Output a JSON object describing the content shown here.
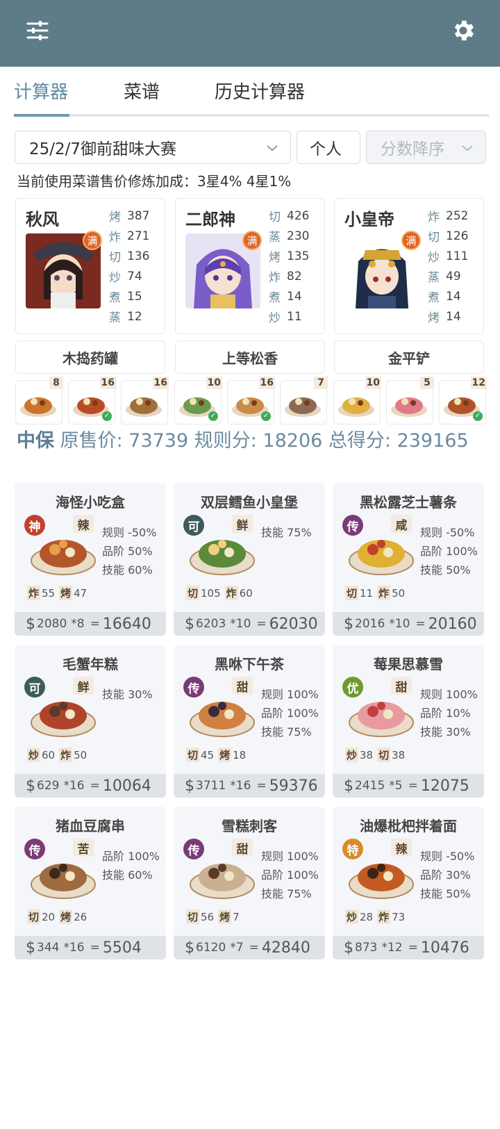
{
  "appbar": {
    "filter_icon": "sliders-icon",
    "settings_icon": "gear-icon"
  },
  "tabs": [
    {
      "label": "计算器",
      "active": true
    },
    {
      "label": "菜谱",
      "active": false
    },
    {
      "label": "历史计算器",
      "active": false
    }
  ],
  "filters": {
    "contest": "25/2/7御前甜味大赛",
    "mode": "个人",
    "sort": "分数降序"
  },
  "bonus_text": "当前使用菜谱售价修炼加成：3星4% 4星1%",
  "chefs": [
    {
      "name": "秋风",
      "badge": "满",
      "skills": [
        [
          "烤",
          "387"
        ],
        [
          "炸",
          "271"
        ],
        [
          "切",
          "136"
        ],
        [
          "炒",
          "74"
        ],
        [
          "煮",
          "15"
        ],
        [
          "蒸",
          "12"
        ]
      ]
    },
    {
      "name": "二郎神",
      "badge": "满",
      "skills": [
        [
          "切",
          "426"
        ],
        [
          "蒸",
          "230"
        ],
        [
          "烤",
          "135"
        ],
        [
          "炸",
          "82"
        ],
        [
          "煮",
          "14"
        ],
        [
          "炒",
          "11"
        ]
      ]
    },
    {
      "name": "小皇帝",
      "badge": "满",
      "skills": [
        [
          "炸",
          "252"
        ],
        [
          "切",
          "126"
        ],
        [
          "炒",
          "111"
        ],
        [
          "蒸",
          "49"
        ],
        [
          "煮",
          "14"
        ],
        [
          "烤",
          "14"
        ]
      ]
    }
  ],
  "equipment": [
    "木捣药罐",
    "上等松香",
    "金平铲"
  ],
  "materials": [
    {
      "count": "8",
      "checked": false
    },
    {
      "count": "16",
      "checked": true
    },
    {
      "count": "16",
      "checked": false
    },
    {
      "count": "10",
      "checked": true
    },
    {
      "count": "16",
      "checked": true
    },
    {
      "count": "7",
      "checked": false
    },
    {
      "count": "10",
      "checked": false
    },
    {
      "count": "5",
      "checked": false
    },
    {
      "count": "12",
      "checked": true
    }
  ],
  "summary": {
    "grade": "中保",
    "text": " 原售价:  73739 规则分:  18206 总得分:  239165"
  },
  "dishes": [
    {
      "name": "海怪小吃盒",
      "rarity": "神",
      "rarity_color": "#c2402e",
      "flavor": "辣",
      "bonuses": [
        "规则 -50%",
        "品阶 50%",
        "技能 60%"
      ],
      "reqs": [
        [
          "炸",
          "55"
        ],
        [
          "烤",
          "47"
        ]
      ],
      "price": "2080",
      "qty": "*8",
      "total": "16640"
    },
    {
      "name": "双层鳕鱼小皇堡",
      "rarity": "可",
      "rarity_color": "#3d5a5c",
      "flavor": "鲜",
      "bonuses": [
        "技能 75%"
      ],
      "reqs": [
        [
          "切",
          "105"
        ],
        [
          "炸",
          "60"
        ]
      ],
      "price": "6203",
      "qty": "*10",
      "total": "62030"
    },
    {
      "name": "黑松露芝士薯条",
      "rarity": "传",
      "rarity_color": "#7b3a78",
      "flavor": "咸",
      "bonuses": [
        "规则 -50%",
        "品阶 100%",
        "技能 50%"
      ],
      "reqs": [
        [
          "切",
          "11"
        ],
        [
          "炸",
          "50"
        ]
      ],
      "price": "2016",
      "qty": "*10",
      "total": "20160"
    },
    {
      "name": "毛蟹年糕",
      "rarity": "可",
      "rarity_color": "#3d5a5c",
      "flavor": "鲜",
      "bonuses": [
        "技能 30%"
      ],
      "reqs": [
        [
          "炒",
          "60"
        ],
        [
          "炸",
          "50"
        ]
      ],
      "price": "629",
      "qty": "*16",
      "total": "10064"
    },
    {
      "name": "黑咻下午茶",
      "rarity": "传",
      "rarity_color": "#7b3a78",
      "flavor": "甜",
      "bonuses": [
        "规则 100%",
        "品阶 100%",
        "技能 75%"
      ],
      "reqs": [
        [
          "切",
          "45"
        ],
        [
          "烤",
          "18"
        ]
      ],
      "price": "3711",
      "qty": "*16",
      "total": "59376"
    },
    {
      "name": "莓果思慕雪",
      "rarity": "优",
      "rarity_color": "#6f9a2e",
      "flavor": "甜",
      "bonuses": [
        "规则 100%",
        "品阶 10%",
        "技能 30%"
      ],
      "reqs": [
        [
          "炒",
          "38"
        ],
        [
          "切",
          "38"
        ]
      ],
      "price": "2415",
      "qty": "*5",
      "total": "12075"
    },
    {
      "name": "猪血豆腐串",
      "rarity": "传",
      "rarity_color": "#7b3a78",
      "flavor": "苦",
      "bonuses": [
        "品阶 100%",
        "技能 60%"
      ],
      "reqs": [
        [
          "切",
          "20"
        ],
        [
          "烤",
          "26"
        ]
      ],
      "price": "344",
      "qty": "*16",
      "total": "5504"
    },
    {
      "name": "雪糕刺客",
      "rarity": "传",
      "rarity_color": "#7b3a78",
      "flavor": "甜",
      "bonuses": [
        "规则 100%",
        "品阶 100%",
        "技能 75%"
      ],
      "reqs": [
        [
          "切",
          "56"
        ],
        [
          "烤",
          "7"
        ]
      ],
      "price": "6120",
      "qty": "*7",
      "total": "42840"
    },
    {
      "name": "油爆枇杷拌着面",
      "rarity": "特",
      "rarity_color": "#d98a2b",
      "flavor": "辣",
      "bonuses": [
        "规则 -50%",
        "品阶 30%",
        "技能 50%"
      ],
      "reqs": [
        [
          "炒",
          "28"
        ],
        [
          "炸",
          "73"
        ]
      ],
      "price": "873",
      "qty": "*12",
      "total": "10476"
    }
  ]
}
